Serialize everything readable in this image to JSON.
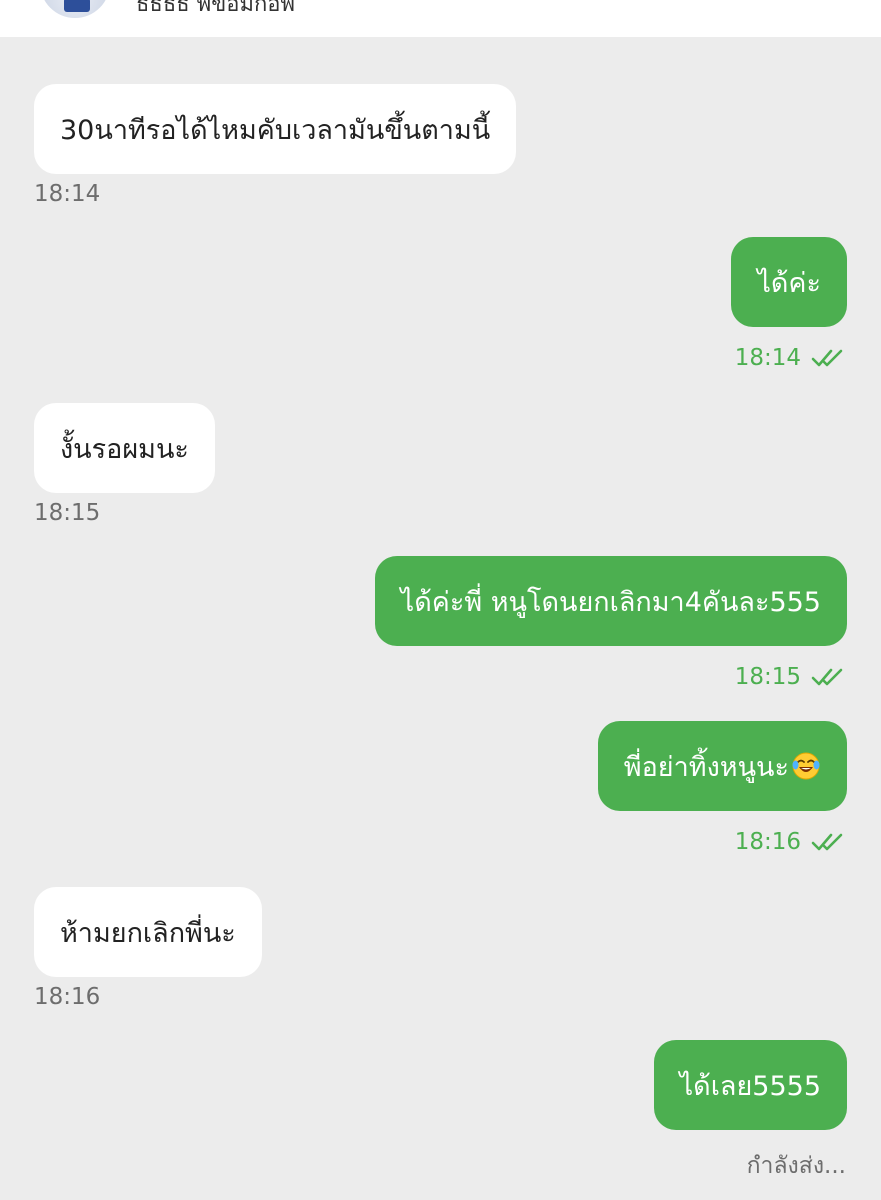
{
  "header": {
    "contact_name": "ธธธธ พี่ขอมิกอพี่"
  },
  "messages": [
    {
      "direction": "in",
      "text": "30นาทีรอได้ไหมคับเวลามันขึ้นตามนี้",
      "time": "18:14"
    },
    {
      "direction": "out",
      "text": "ได้ค่ะ",
      "time": "18:14",
      "read": true
    },
    {
      "direction": "in",
      "text": "งั้นรอผมนะ",
      "time": "18:15"
    },
    {
      "direction": "out",
      "text": "ได้ค่ะพี่ หนูโดนยกเลิกมา4คันละ555",
      "time": "18:15",
      "read": true
    },
    {
      "direction": "out",
      "text": "พี่อย่าทิ้งหนูนะ",
      "emoji": "laughing-tears-emoji",
      "time": "18:16",
      "read": true
    },
    {
      "direction": "in",
      "text": "ห้ามยกเลิกพี่นะ",
      "time": "18:16"
    },
    {
      "direction": "out",
      "text": "ได้เลย5555",
      "status": "กำลังส่ง..."
    }
  ],
  "colors": {
    "background": "#ececec",
    "incoming_bubble": "#ffffff",
    "outgoing_bubble": "#4caf50",
    "outgoing_time": "#4caf50",
    "incoming_time": "#6d6d6d"
  }
}
